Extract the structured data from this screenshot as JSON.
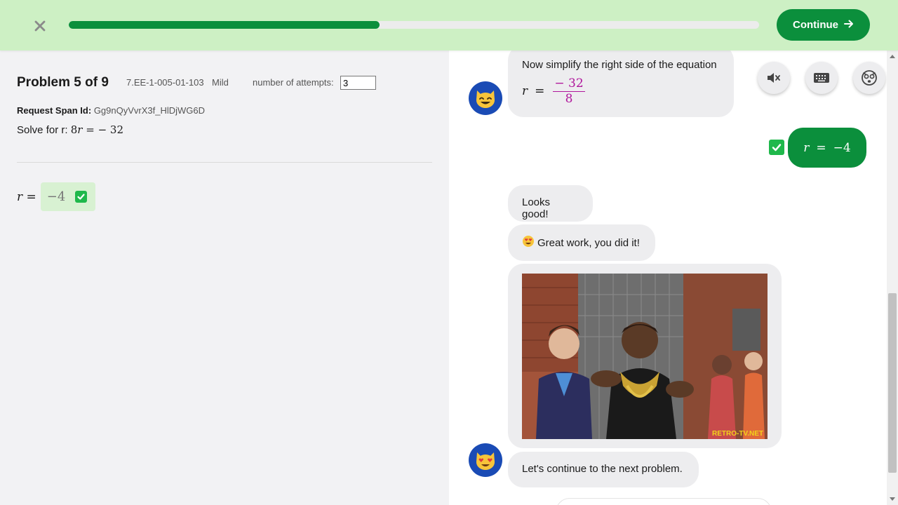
{
  "header": {
    "close_icon": "close-icon",
    "progress": 0.45,
    "continue_label": "Continue",
    "continue_icon": "arrow-right-icon",
    "accent": "#0b8f3c",
    "bar_bg": "#cdf0c4"
  },
  "problem": {
    "title": "Problem 5 of 9",
    "code": "7.EE-1-005-01-103",
    "difficulty": "Mild",
    "attempts_label": "number of attempts:",
    "attempts_value": "3",
    "span_label": "Request Span Id:",
    "span_value": "Gg9nQyVvrX3f_HlDjWG6D",
    "solve_prefix": "Solve for r:",
    "equation": {
      "coef": "8",
      "var": "r",
      "equals": "=",
      "rhs": "− 32"
    },
    "answer": {
      "var": "r",
      "equals": "=",
      "value": "−4",
      "status_icon": "check-icon"
    }
  },
  "chat": {
    "messages": [
      {
        "text": "Now simplify the right side of the equation",
        "equation": {
          "var": "r",
          "equals": "=",
          "numerator": "− 32",
          "denominator": "8"
        }
      },
      {
        "user_answer": {
          "var": "r",
          "equals": "=",
          "value": "−4"
        }
      },
      {
        "text": "Looks good!"
      },
      {
        "text": "Great work, you did it!",
        "emoji": "heart-eyes-emoji"
      },
      {
        "gif_caption": "RETRO-TV.NET",
        "gif_icon": "celebration-gif"
      },
      {
        "text": "Let's continue to the next problem."
      }
    ],
    "tools": [
      {
        "icon": "mute-icon"
      },
      {
        "icon": "keyboard-icon"
      },
      {
        "icon": "help-face-icon"
      }
    ],
    "avatar_icon": "cat-face-avatar"
  }
}
